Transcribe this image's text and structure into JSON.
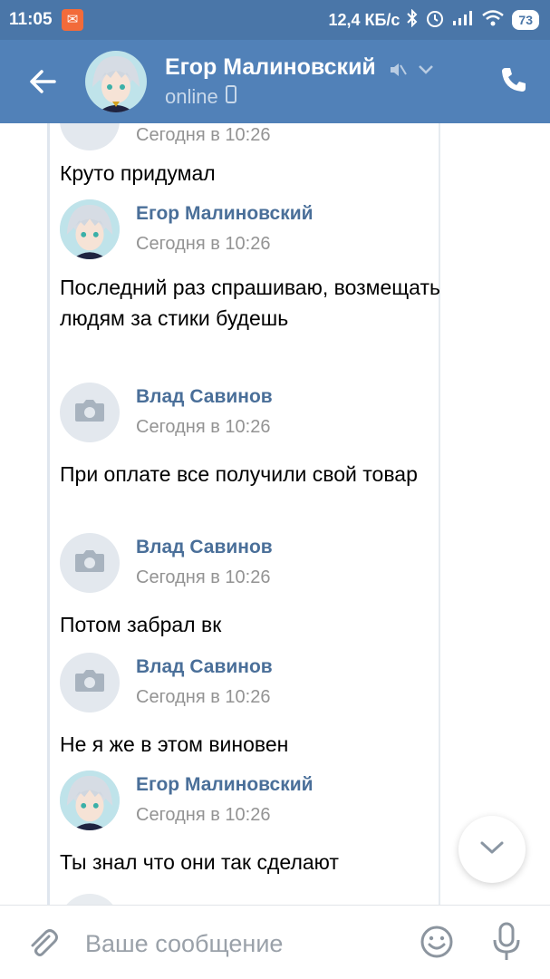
{
  "status_bar": {
    "time": "11:05",
    "network_speed": "12,4 КБ/с",
    "battery": "73"
  },
  "header": {
    "name": "Егор Малиновский",
    "status": "online"
  },
  "messages": [
    {
      "name": "",
      "time": "Сегодня в 10:26",
      "text": "Круто придумал",
      "avatar": "anime-avatar"
    },
    {
      "name": "Егор Малиновский",
      "time": "Сегодня в 10:26",
      "text": "Последний раз спрашиваю, возмещать людям за стики будешь",
      "avatar": "anime-avatar"
    },
    {
      "name": "Влад Савинов",
      "time": "Сегодня в 10:26",
      "text": "При оплате все получили свой товар",
      "avatar": "camera-icon"
    },
    {
      "name": "Влад Савинов",
      "time": "Сегодня в 10:26",
      "text": "Потом забрал вк",
      "avatar": "camera-icon"
    },
    {
      "name": "Влад Савинов",
      "time": "Сегодня в 10:26",
      "text": "Не я же в этом виновен",
      "avatar": "camera-icon"
    },
    {
      "name": "Егор Малиновский",
      "time": "Сегодня в 10:26",
      "text": "Ты знал что они так сделают",
      "avatar": "anime-avatar"
    }
  ],
  "input": {
    "placeholder": "Ваше сообщение",
    "value": ""
  },
  "colors": {
    "header": "#5181b8",
    "status_bar": "#4a76a8",
    "name_link": "#4a6f99",
    "time_gray": "#939393"
  }
}
